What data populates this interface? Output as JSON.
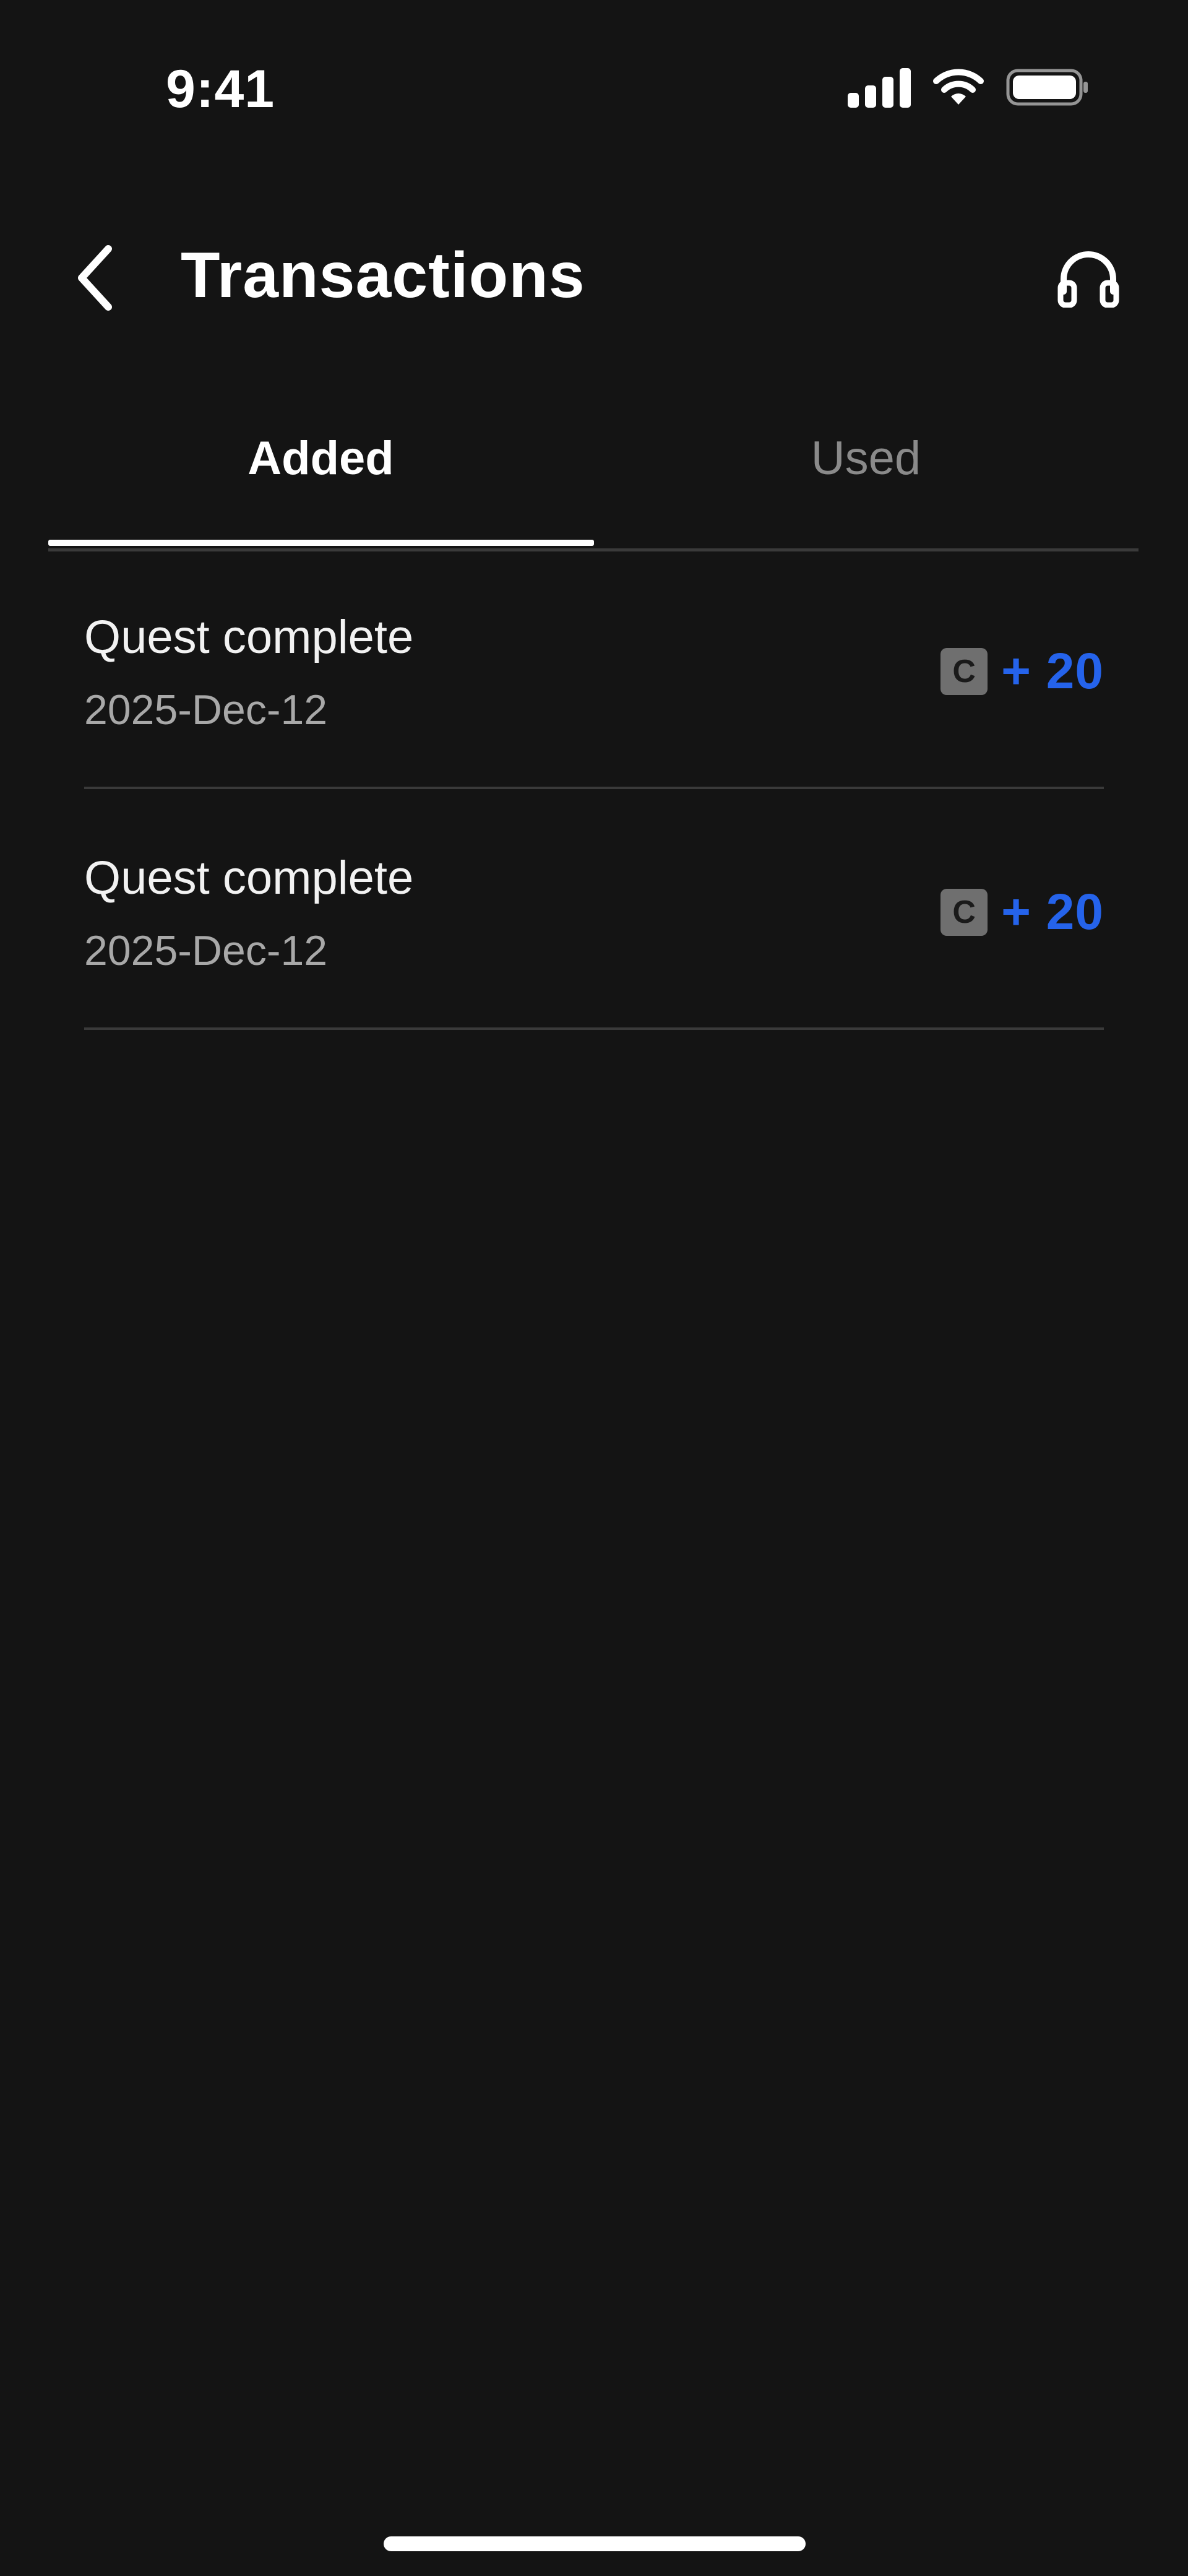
{
  "status_bar": {
    "time": "9:41",
    "icons": [
      "cellular-signal-icon",
      "wifi-icon",
      "battery-icon"
    ]
  },
  "header": {
    "title": "Transactions",
    "back_icon": "chevron-left-icon",
    "support_icon": "headphones-icon"
  },
  "tabs": [
    {
      "label": "Added",
      "active": true
    },
    {
      "label": "Used",
      "active": false
    }
  ],
  "transactions": [
    {
      "title": "Quest complete",
      "date": "2025-Dec-12",
      "coin": "C",
      "amount": "+ 20"
    },
    {
      "title": "Quest complete",
      "date": "2025-Dec-12",
      "coin": "C",
      "amount": "+ 20"
    }
  ],
  "colors": {
    "background": "#141414",
    "accent": "#2563eb",
    "muted_text": "#a8a8a8",
    "divider": "#3a3a3a"
  }
}
